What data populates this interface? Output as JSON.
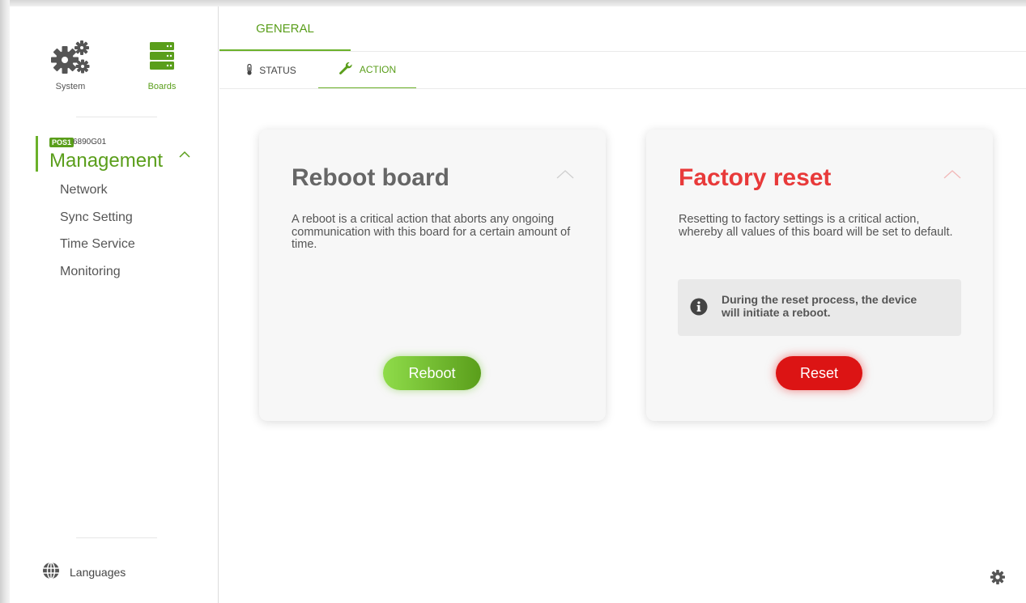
{
  "sidebar": {
    "system_label": "System",
    "boards_label": "Boards",
    "pos_badge": "POS1",
    "board_id": "6890G01",
    "section_title": "Management",
    "menu": [
      "Network",
      "Sync Setting",
      "Time Service",
      "Monitoring"
    ],
    "languages_label": "Languages"
  },
  "tabs": {
    "general": "GENERAL",
    "status": "STATUS",
    "action": "ACTION"
  },
  "reboot_card": {
    "title": "Reboot board",
    "description": "A reboot is a critical action that aborts any ongoing communication with this board for a certain amount of time.",
    "button": "Reboot"
  },
  "reset_card": {
    "title": "Factory reset",
    "description": "Resetting to factory settings is a critical action, whereby all values of this board will be set to default.",
    "info": "During the reset process, the device will initiate a reboot.",
    "button": "Reset"
  },
  "colors": {
    "accent_green": "#5a9e1b",
    "danger_red": "#e83a3a",
    "reset_button": "#dc1414"
  },
  "icons": {
    "system": "gears-icon",
    "boards": "server-stack-icon",
    "languages": "globe-icon",
    "status": "thermometer-icon",
    "action": "wrench-icon",
    "info": "info-circle-icon",
    "settings": "gear-icon"
  }
}
